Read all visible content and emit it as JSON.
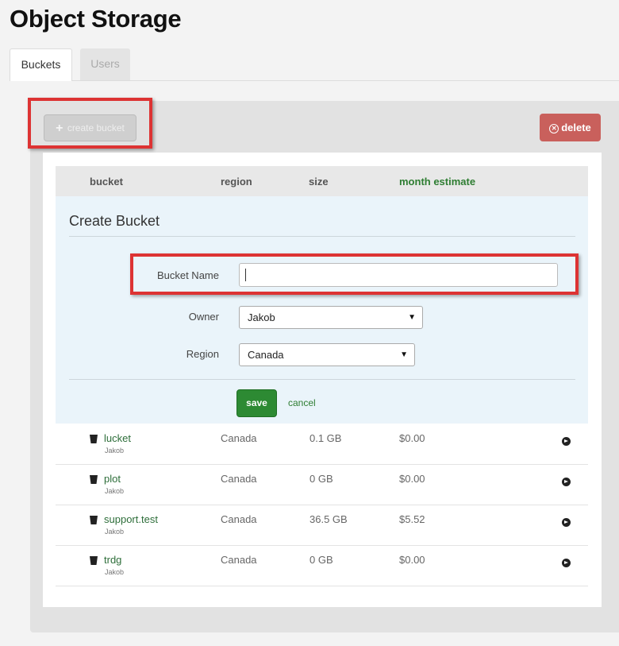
{
  "page": {
    "title": "Object Storage"
  },
  "tabs": [
    {
      "label": "Buckets",
      "active": true
    },
    {
      "label": "Users",
      "active": false
    }
  ],
  "toolbar": {
    "create_label": "create bucket",
    "delete_label": "delete"
  },
  "table": {
    "columns": {
      "bucket": "bucket",
      "region": "region",
      "size": "size",
      "month": "month estimate"
    },
    "rows": [
      {
        "name": "lucket",
        "owner": "Jakob",
        "region": "Canada",
        "size": "0.1 GB",
        "estimate": "$0.00"
      },
      {
        "name": "plot",
        "owner": "Jakob",
        "region": "Canada",
        "size": "0 GB",
        "estimate": "$0.00"
      },
      {
        "name": "support.test",
        "owner": "Jakob",
        "region": "Canada",
        "size": "36.5 GB",
        "estimate": "$5.52"
      },
      {
        "name": "trdg",
        "owner": "Jakob",
        "region": "Canada",
        "size": "0 GB",
        "estimate": "$0.00"
      }
    ]
  },
  "create_form": {
    "title": "Create Bucket",
    "bucket_name_label": "Bucket Name",
    "bucket_name_value": "",
    "owner_label": "Owner",
    "owner_value": "Jakob",
    "region_label": "Region",
    "region_value": "Canada",
    "save_label": "save",
    "cancel_label": "cancel"
  },
  "colors": {
    "accent_green": "#2e7d32",
    "delete_red": "#c9605c",
    "highlight_red": "#dd3333",
    "form_bg": "#eaf4fa"
  },
  "icons": {
    "create": "plus-icon",
    "delete": "circle-x-icon",
    "bucket": "bucket-icon",
    "row_action": "arrow-circle-icon",
    "select": "caret-down-icon"
  }
}
